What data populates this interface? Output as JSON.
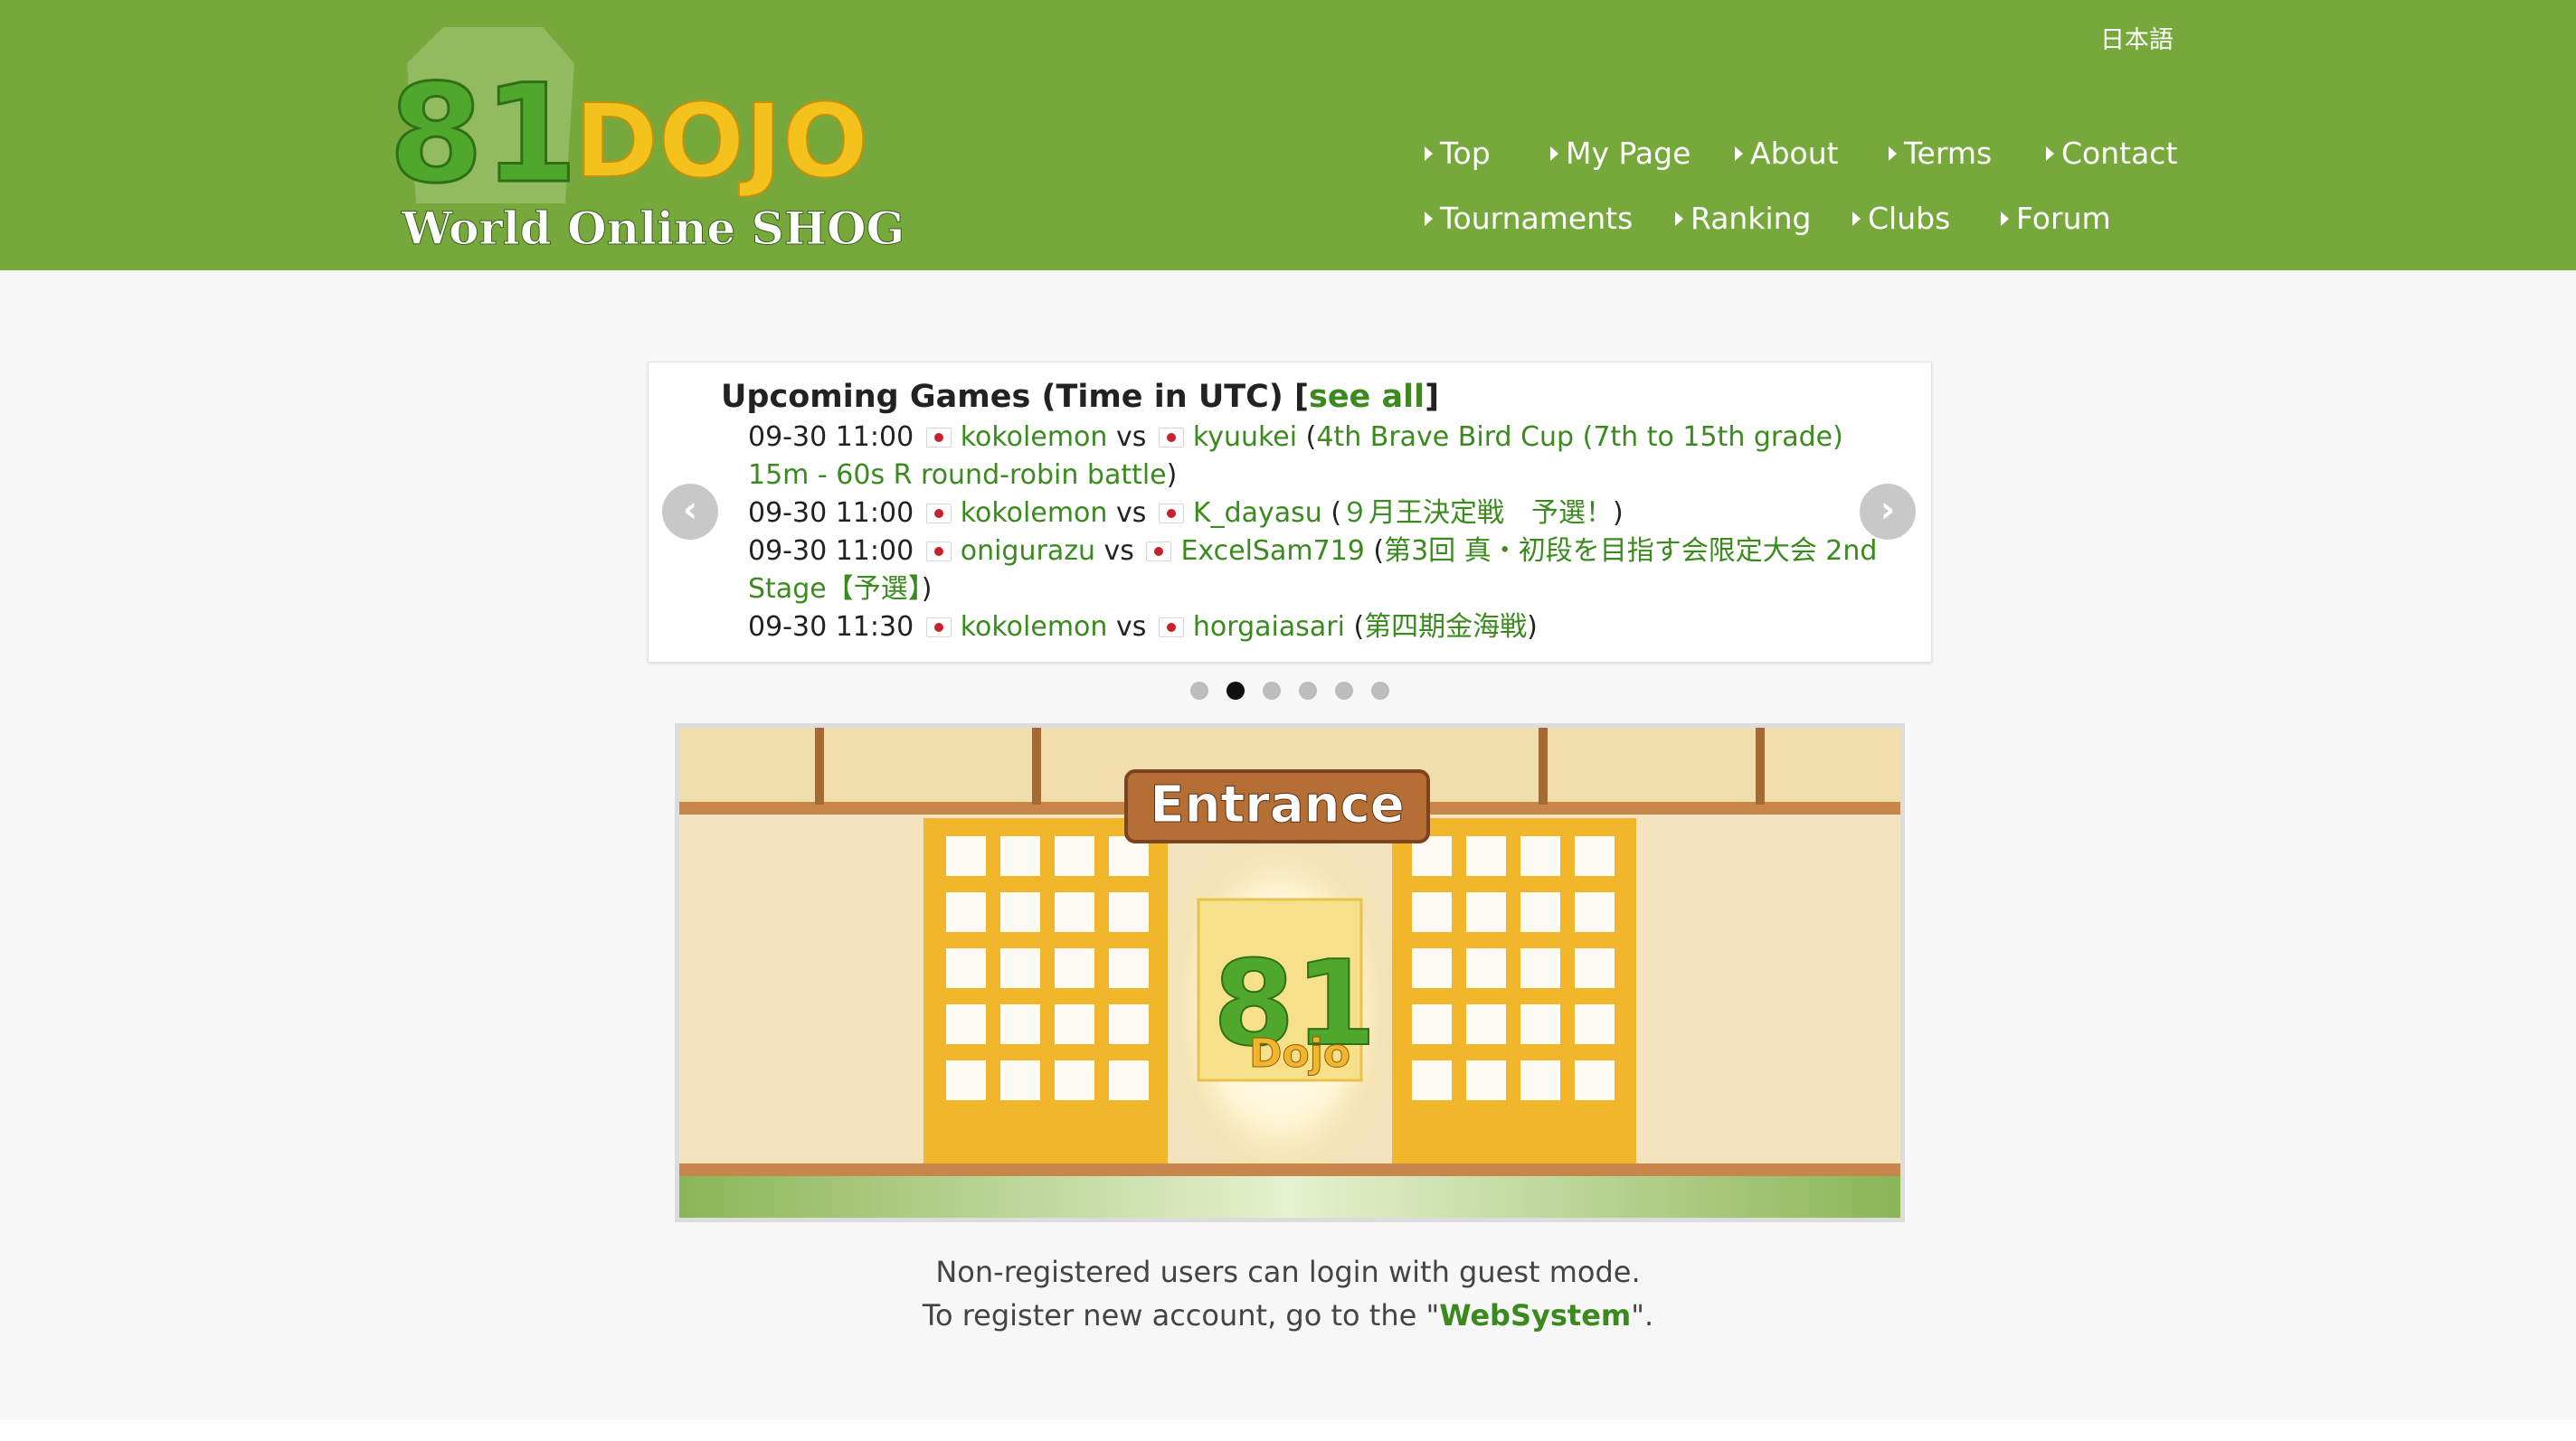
{
  "header": {
    "logo_number": "81",
    "logo_word": "DOJO",
    "logo_tagline": "World Online SHOGI",
    "language_link": "日本語"
  },
  "nav": {
    "row1": [
      "Top",
      "My Page",
      "About",
      "Terms",
      "Contact"
    ],
    "row2": [
      "Tournaments",
      "Ranking",
      "Clubs",
      "Forum"
    ]
  },
  "upcoming": {
    "title": "Upcoming Games (Time in UTC) ",
    "bracket_open": "[",
    "see_all": "see all",
    "bracket_close": "]",
    "games": [
      {
        "time": "09-30 11:00",
        "player1": "kokolemon",
        "vs": "vs",
        "player2": "kyuukei",
        "event": "4th Brave Bird Cup (7th to 15th grade) 15m - 60s R round-robin battle"
      },
      {
        "time": "09-30 11:00",
        "player1": "kokolemon",
        "vs": "vs",
        "player2": "K_dayasu",
        "event": "９月王決定戦　予選！"
      },
      {
        "time": "09-30 11:00",
        "player1": "onigurazu",
        "vs": "vs",
        "player2": "ExcelSam719",
        "event": "第3回 真・初段を目指す会限定大会 2nd Stage【予選】"
      },
      {
        "time": "09-30 11:30",
        "player1": "kokolemon",
        "vs": "vs",
        "player2": "horgaiasari",
        "event": "第四期金海戦"
      }
    ],
    "carousel_pages": 6,
    "active_page_index": 1
  },
  "entrance": {
    "sign": "Entrance",
    "badge_number": "81",
    "badge_word": "Dojo"
  },
  "notes": {
    "line1": "Non-registered users can login with guest mode.",
    "line2_prefix": "To register new account, go to the \"",
    "line2_link": "WebSystem",
    "line2_suffix": "\"."
  },
  "colors": {
    "header_green": "#77a83c",
    "link_green": "#3a8a1e",
    "flag_red": "#c9202d"
  }
}
